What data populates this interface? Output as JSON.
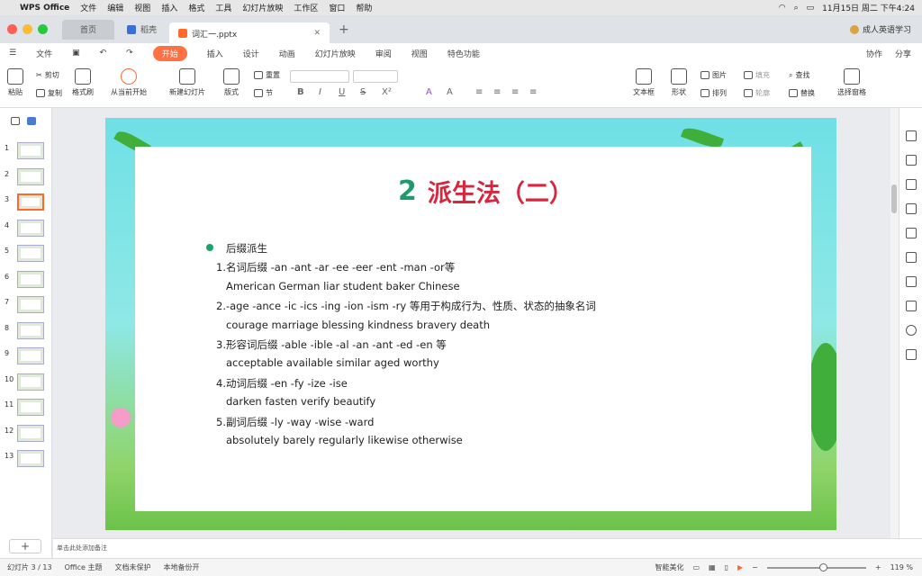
{
  "menubar": {
    "app": "WPS Office",
    "items": [
      "文件",
      "编辑",
      "视图",
      "插入",
      "格式",
      "工具",
      "幻灯片放映",
      "工作区",
      "窗口",
      "帮助"
    ],
    "clock": "11月15日 周二 下午4:24"
  },
  "tabs": {
    "home": "首页",
    "daoke": "稻壳",
    "doc": "词汇一.pptx",
    "user": "成人英语学习"
  },
  "ribbon_tabs": {
    "file": "文件",
    "items": [
      "开始",
      "插入",
      "设计",
      "动画",
      "幻灯片放映",
      "审阅",
      "视图",
      "特色功能"
    ],
    "collab": "协作",
    "share": "分享"
  },
  "ribbon": {
    "paste": "粘贴",
    "cut": "剪切",
    "copy": "复制",
    "format_painter": "格式刷",
    "from_current": "从当前开始",
    "new_slide": "新建幻灯片",
    "layout": "版式",
    "reset": "重置",
    "section": "节",
    "textbox": "文本框",
    "shape": "形状",
    "picture": "图片",
    "arrange": "排列",
    "fill": "填充",
    "outline": "轮廓",
    "find": "查找",
    "replace": "替换",
    "select_pane": "选择窗格"
  },
  "thumbnails": {
    "count": 13,
    "selected": 3
  },
  "slide": {
    "title_num": "2",
    "title_text": "派生法（二）",
    "lines": [
      "后缀派生",
      "1.名词后缀 -an -ant -ar -ee -eer -ent -man -or等",
      "American German liar student baker Chinese",
      "2.-age -ance -ic -ics -ing -ion -ism -ry 等用于构成行为、性质、状态的抽象名词",
      "courage marriage blessing kindness bravery death",
      "3.形容词后缀 -able -ible -al -an -ant -ed -en 等",
      "acceptable available similar aged worthy",
      "4.动词后缀 -en -fy -ize -ise",
      "darken fasten verify beautify",
      "5.副词后缀  -ly -way -wise -ward",
      "absolutely barely regularly likewise  otherwise"
    ]
  },
  "notes_placeholder": "单击此处添加备注",
  "status": {
    "slide_info": "幻灯片 3 / 13",
    "theme": "Office 主题",
    "doc_state": "文档未保护",
    "backup": "本地备份开",
    "beautify": "智能美化",
    "zoom": "119 %"
  },
  "colors": {
    "accent": "#ff7043",
    "title_red": "#d7263d",
    "title_green": "#1f9b6b"
  }
}
